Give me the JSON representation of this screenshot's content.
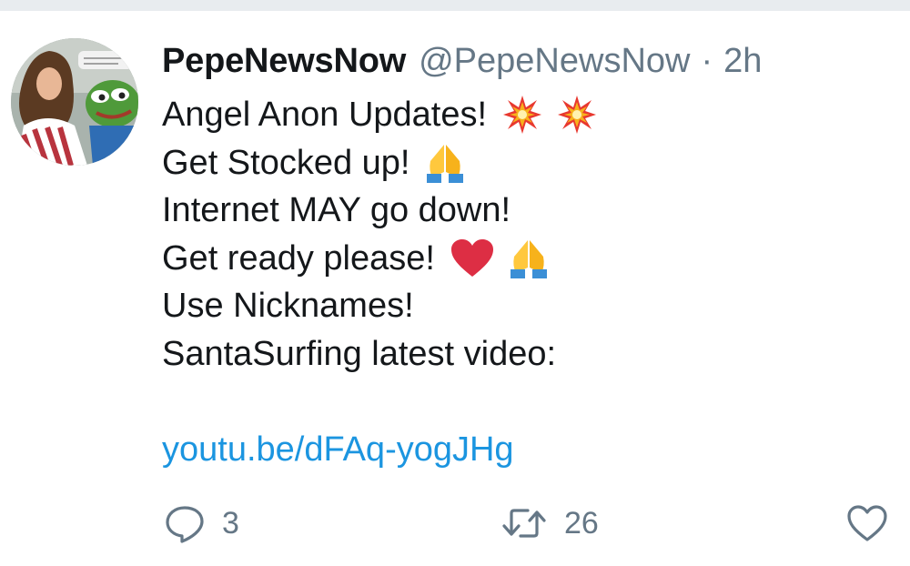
{
  "colors": {
    "text": "#14171a",
    "secondary": "#657786",
    "link": "#1b95e0",
    "heart": "#e0245e"
  },
  "tweet": {
    "display_name": "PepeNewsNow",
    "handle": "@PepeNewsNow",
    "separator": "·",
    "time": "2h",
    "lines": {
      "l1": "Angel Anon Updates!",
      "l2": "Get Stocked up!",
      "l3": "Internet MAY go down!",
      "l4": "Get ready please!",
      "l5": "Use Nicknames!",
      "l6": "SantaSurfing latest video:"
    },
    "link": "youtu.be/dFAq-yogJHg",
    "emojis": {
      "l1": [
        "collision-icon",
        "collision-icon"
      ],
      "l2": [
        "folded-hands-icon"
      ],
      "l4": [
        "red-heart-icon",
        "folded-hands-icon"
      ]
    }
  },
  "actions": {
    "reply_count": "3",
    "retweet_count": "26",
    "icons": [
      "reply-icon",
      "retweet-icon",
      "like-icon"
    ]
  }
}
